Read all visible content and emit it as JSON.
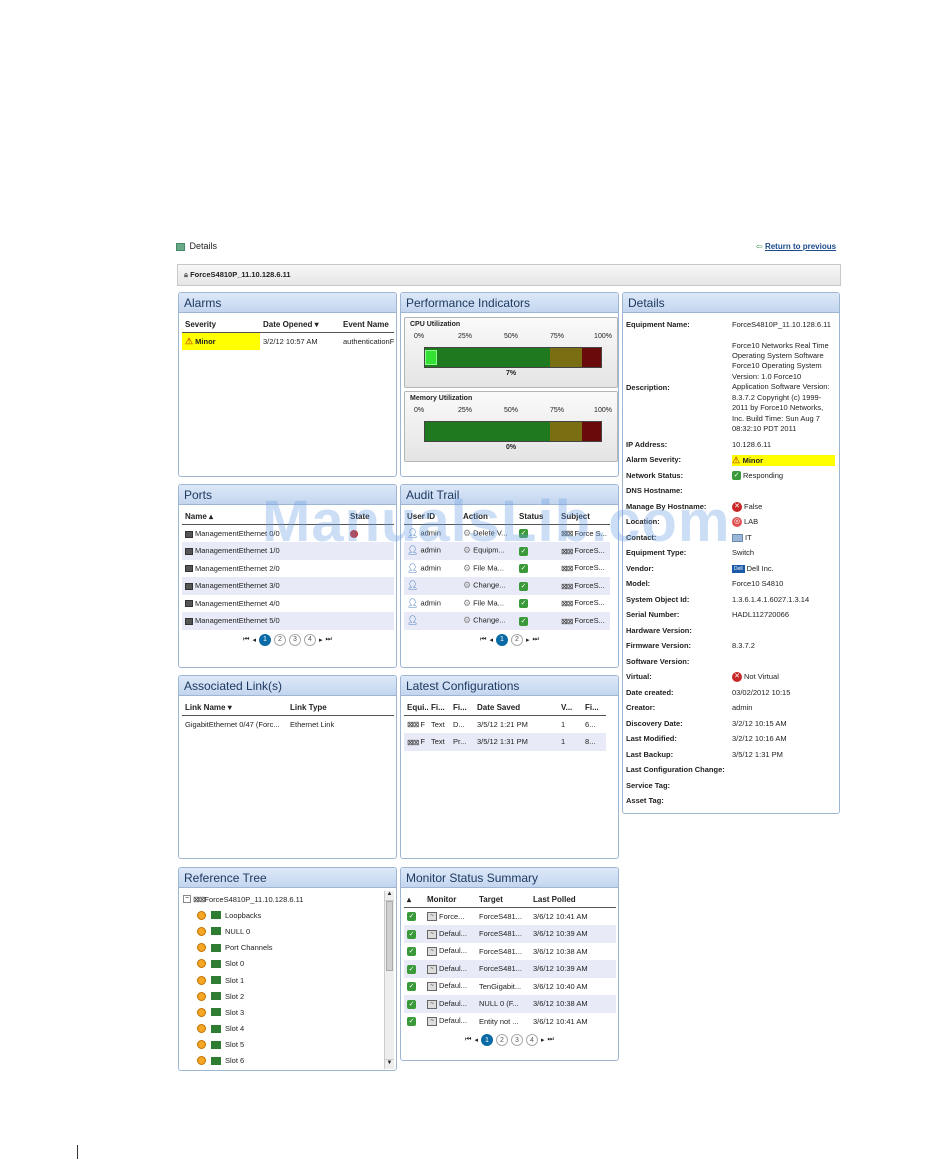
{
  "header": {
    "title": "Details",
    "return_link": "Return to previous",
    "device_bar": "ForceS4810P_11.10.128.6.11"
  },
  "alarms": {
    "title": "Alarms",
    "columns": [
      "Severity",
      "Date Opened",
      "Event Name"
    ],
    "rows": [
      {
        "severity": "Minor",
        "date": "3/2/12 10:57 AM",
        "event": "authenticationFail"
      }
    ]
  },
  "performance": {
    "title": "Performance Indicators",
    "ticks": [
      "0%",
      "25%",
      "50%",
      "75%",
      "100%"
    ],
    "cpu": {
      "label": "CPU Utilization",
      "value": 7,
      "value_text": "7%"
    },
    "memory": {
      "label": "Memory Utilization",
      "value": 0,
      "value_text": "0%"
    }
  },
  "details": {
    "title": "Details",
    "fields": [
      {
        "k": "Equipment Name:",
        "v": "ForceS4810P_11.10.128.6.11"
      },
      {
        "k": "Description:",
        "v": "Force10 Networks Real Time Operating System Software Force10 Operating System Version: 1.0 Force10 Application Software Version: 8.3.7.2 Copyright (c) 1999-2011 by Force10 Networks, Inc. Build Time: Sun Aug 7 08:32:10 PDT 2011"
      },
      {
        "k": "IP Address:",
        "v": "10.128.6.11"
      },
      {
        "k": "Alarm Severity:",
        "v": "Minor"
      },
      {
        "k": "Network Status:",
        "v": "Responding"
      },
      {
        "k": "DNS Hostname:",
        "v": ""
      },
      {
        "k": "Manage By Hostname:",
        "v": "False"
      },
      {
        "k": "Location:",
        "v": "LAB"
      },
      {
        "k": "Contact:",
        "v": "IT"
      },
      {
        "k": "Equipment Type:",
        "v": "Switch"
      },
      {
        "k": "Vendor:",
        "v": "Dell Inc."
      },
      {
        "k": "Model:",
        "v": "Force10 S4810"
      },
      {
        "k": "System Object Id:",
        "v": "1.3.6.1.4.1.6027.1.3.14"
      },
      {
        "k": "Serial Number:",
        "v": "HADL112720066"
      },
      {
        "k": "Hardware Version:",
        "v": ""
      },
      {
        "k": "Firmware Version:",
        "v": "8.3.7.2"
      },
      {
        "k": "Software Version:",
        "v": ""
      },
      {
        "k": "Virtual:",
        "v": "Not Virtual"
      },
      {
        "k": "Date created:",
        "v": "03/02/2012 10:15"
      },
      {
        "k": "Creator:",
        "v": "admin"
      },
      {
        "k": "Discovery Date:",
        "v": "3/2/12 10:15 AM"
      },
      {
        "k": "Last Modified:",
        "v": "3/2/12 10:16 AM"
      },
      {
        "k": "Last Backup:",
        "v": "3/5/12 1:31 PM"
      },
      {
        "k": "Last Configuration Change:",
        "v": ""
      },
      {
        "k": "Service Tag:",
        "v": ""
      },
      {
        "k": "Asset Tag:",
        "v": ""
      }
    ],
    "vendor_badge": "Dell"
  },
  "ports": {
    "title": "Ports",
    "columns": [
      "Name",
      "State"
    ],
    "rows": [
      {
        "name": "ManagementEthernet 0/0"
      },
      {
        "name": "ManagementEthernet 1/0"
      },
      {
        "name": "ManagementEthernet 2/0"
      },
      {
        "name": "ManagementEthernet 3/0"
      },
      {
        "name": "ManagementEthernet 4/0"
      },
      {
        "name": "ManagementEthernet 5/0"
      }
    ],
    "pages": [
      "1",
      "2",
      "3",
      "4"
    ]
  },
  "audit": {
    "title": "Audit Trail",
    "columns": [
      "User ID",
      "Action",
      "Status",
      "Subject"
    ],
    "rows": [
      {
        "user": "admin",
        "action": "Delete V...",
        "subject": "Force S..."
      },
      {
        "user": "admin",
        "action": "Equipm...",
        "subject": "ForceS..."
      },
      {
        "user": "admin",
        "action": "File Ma...",
        "subject": "ForceS..."
      },
      {
        "user": "",
        "action": "Change...",
        "subject": "ForceS..."
      },
      {
        "user": "admin",
        "action": "File Ma...",
        "subject": "ForceS..."
      },
      {
        "user": "",
        "action": "Change...",
        "subject": "ForceS..."
      }
    ],
    "pages": [
      "1",
      "2"
    ]
  },
  "links": {
    "title": "Associated Link(s)",
    "columns": [
      "Link Name",
      "Link Type"
    ],
    "rows": [
      {
        "name": "GigabitEthernet 0/47 (Forc...",
        "type": "Ethernet Link"
      }
    ]
  },
  "configs": {
    "title": "Latest Configurations",
    "columns": [
      "Equi...",
      "Fi...",
      "Fi...",
      "Date Saved",
      "V...",
      "Fi..."
    ],
    "rows": [
      {
        "eq": "F",
        "f1": "Text",
        "f2": "D...",
        "date": "3/5/12 1:21 PM",
        "v": "1",
        "f3": "6..."
      },
      {
        "eq": "F",
        "f1": "Text",
        "f2": "Pr...",
        "date": "3/5/12 1:31 PM",
        "v": "1",
        "f3": "8..."
      }
    ]
  },
  "tree": {
    "title": "Reference Tree",
    "root": "ForceS4810P_11.10.128.6.11",
    "items": [
      "Loopbacks",
      "NULL 0",
      "Port Channels",
      "Slot 0",
      "Slot 1",
      "Slot 2",
      "Slot 3",
      "Slot 4",
      "Slot 5",
      "Slot 6"
    ]
  },
  "monitor": {
    "title": "Monitor Status Summary",
    "columns": [
      "Monitor",
      "Target",
      "Last Polled"
    ],
    "rows": [
      {
        "monitor": "Force...",
        "target": "ForceS481...",
        "polled": "3/6/12 10:41 AM"
      },
      {
        "monitor": "Defaul...",
        "target": "ForceS481...",
        "polled": "3/6/12 10:39 AM"
      },
      {
        "monitor": "Defaul...",
        "target": "ForceS481...",
        "polled": "3/6/12 10:38 AM"
      },
      {
        "monitor": "Defaul...",
        "target": "ForceS481...",
        "polled": "3/6/12 10:39 AM"
      },
      {
        "monitor": "Defaul...",
        "target": "TenGigabit...",
        "polled": "3/6/12 10:40 AM"
      },
      {
        "monitor": "Defaul...",
        "target": "NULL 0 (F...",
        "polled": "3/6/12 10:38 AM"
      },
      {
        "monitor": "Defaul...",
        "target": "Entity not ...",
        "polled": "3/6/12 10:41 AM"
      }
    ],
    "pages": [
      "1",
      "2",
      "3",
      "4"
    ]
  },
  "watermark": "ManualsLib.com",
  "colors": {
    "minor_highlight": "#ffff00",
    "accent": "#0a6aa5",
    "panel_header": "#c3d6ef"
  }
}
